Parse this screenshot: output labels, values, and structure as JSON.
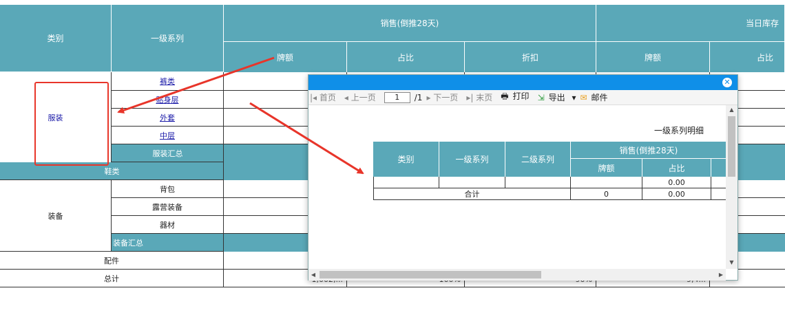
{
  "main_table": {
    "headers": {
      "category": "类别",
      "series1": "一级系列",
      "sales_group": "销售(倒推28天)",
      "stock_group": "当日库存",
      "sales_brand": "牌额",
      "sales_ratio": "占比",
      "sales_discount": "折扣",
      "stock_brand": "牌额",
      "stock_ratio": "占比"
    },
    "clothing": {
      "category": "服装",
      "items": [
        "裤类",
        "贴身层",
        "外套",
        "中层"
      ],
      "subtotal": "服装汇总"
    },
    "shoes": "鞋类",
    "equipment": {
      "category": "装备",
      "items": [
        "背包",
        "露营装备",
        "器材"
      ],
      "subtotal": "装备汇总"
    },
    "accessories": "配件",
    "total": "总计",
    "total_partial": [
      "1,002,...",
      "100%",
      "90%",
      "9,4..."
    ]
  },
  "dialog": {
    "toolbar": {
      "first": "首页",
      "prev": "上一页",
      "page": "1",
      "page_total": "/1",
      "next": "下一页",
      "last": "末页",
      "print": "打印",
      "export": "导出",
      "mail": "邮件"
    },
    "report_title": "一级系列明细",
    "headers": {
      "category": "类别",
      "series1": "一级系列",
      "series2": "二级系列",
      "sales_group": "销售(倒推28天)",
      "brand": "牌额",
      "ratio": "占比"
    },
    "rows": [
      {
        "ratio": "0.00"
      }
    ],
    "total": {
      "label": "合计",
      "brand": "0",
      "ratio": "0.00"
    }
  },
  "colors": {
    "header": "#5aa8b8",
    "dialog_title": "#0f8fe8",
    "arrow": "#e8352a",
    "highlight": "#e8352a"
  }
}
